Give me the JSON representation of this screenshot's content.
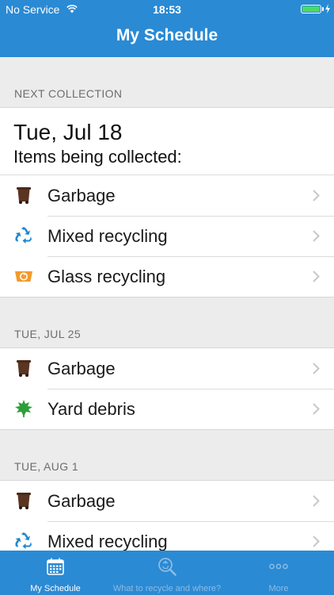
{
  "status_bar": {
    "carrier": "No Service",
    "time": "18:53"
  },
  "nav": {
    "title": "My Schedule"
  },
  "next_collection": {
    "header": "NEXT COLLECTION",
    "date": "Tue, Jul 18",
    "subtitle": "Items being collected:",
    "items": [
      {
        "label": "Garbage",
        "icon": "garbage-bin-icon"
      },
      {
        "label": "Mixed recycling",
        "icon": "recycle-icon"
      },
      {
        "label": "Glass recycling",
        "icon": "glass-bin-icon"
      }
    ]
  },
  "upcoming": [
    {
      "header": "TUE, JUL 25",
      "items": [
        {
          "label": "Garbage",
          "icon": "garbage-bin-icon"
        },
        {
          "label": "Yard debris",
          "icon": "leaf-icon"
        }
      ]
    },
    {
      "header": "TUE, AUG 1",
      "items": [
        {
          "label": "Garbage",
          "icon": "garbage-bin-icon"
        },
        {
          "label": "Mixed recycling",
          "icon": "recycle-icon"
        }
      ]
    }
  ],
  "tabs": [
    {
      "label": "My Schedule",
      "icon": "calendar-icon",
      "active": true
    },
    {
      "label": "What to recycle and where?",
      "icon": "search-recycle-icon",
      "active": false
    },
    {
      "label": "More",
      "icon": "more-dots-icon",
      "active": false
    }
  ],
  "colors": {
    "primary": "#2a8ad4",
    "garbage": "#5a3522",
    "recycle": "#1e88d0",
    "glass": "#f39a2b",
    "yard": "#2e9e3a"
  }
}
